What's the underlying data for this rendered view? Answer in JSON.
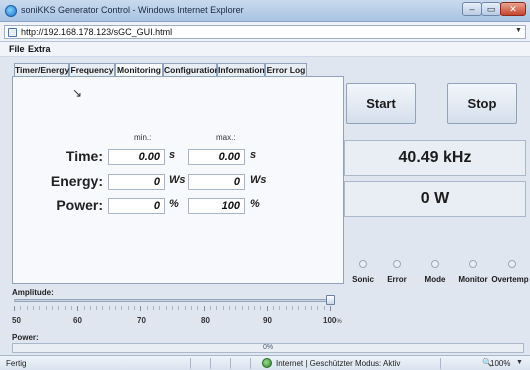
{
  "window": {
    "title": "soniKKS Generator Control - Windows Internet Explorer",
    "minimize": "–",
    "maximize": "▭",
    "close": "✕"
  },
  "address": {
    "url": "http://192.168.178.123/sGC_GUI.html",
    "dropdown": "▼"
  },
  "menu": {
    "file": "File",
    "extra": "Extra"
  },
  "tabs": [
    {
      "label": "Timer/Energy"
    },
    {
      "label": "Frequency"
    },
    {
      "label": "Monitoring",
      "active": true
    },
    {
      "label": "Configuration"
    },
    {
      "label": "Information"
    },
    {
      "label": "Error Log"
    }
  ],
  "monitoring": {
    "min_header": "min.:",
    "max_header": "max.:",
    "rows": [
      {
        "label": "Time:",
        "min": "0.00",
        "max": "0.00",
        "unit_min": "s",
        "unit_max": "s"
      },
      {
        "label": "Energy:",
        "min": "0",
        "max": "0",
        "unit_min": "Ws",
        "unit_max": "Ws"
      },
      {
        "label": "Power:",
        "min": "0",
        "max": "100",
        "unit_min": "%",
        "unit_max": "%"
      }
    ]
  },
  "controls": {
    "start": "Start",
    "stop": "Stop"
  },
  "display": {
    "frequency": "40.49 kHz",
    "power": "0 W"
  },
  "status_leds": [
    {
      "label": "Sonic"
    },
    {
      "label": "Error"
    },
    {
      "label": "Mode"
    },
    {
      "label": "Monitor"
    },
    {
      "label": "Overtemp"
    }
  ],
  "amplitude": {
    "label": "Amplitude:",
    "min": 50,
    "max": 100,
    "value": 100,
    "tick_labels": [
      "50",
      "60",
      "70",
      "80",
      "90",
      "100"
    ],
    "unit": "%"
  },
  "power": {
    "label": "Power:",
    "value_percent": 0,
    "text": "0%"
  },
  "statusbar": {
    "left": "Fertig",
    "zone": "Internet | Geschützter Modus: Aktiv",
    "zoom": "100%",
    "zoom_arrow": "▼",
    "zoom_icon": "🔍"
  }
}
